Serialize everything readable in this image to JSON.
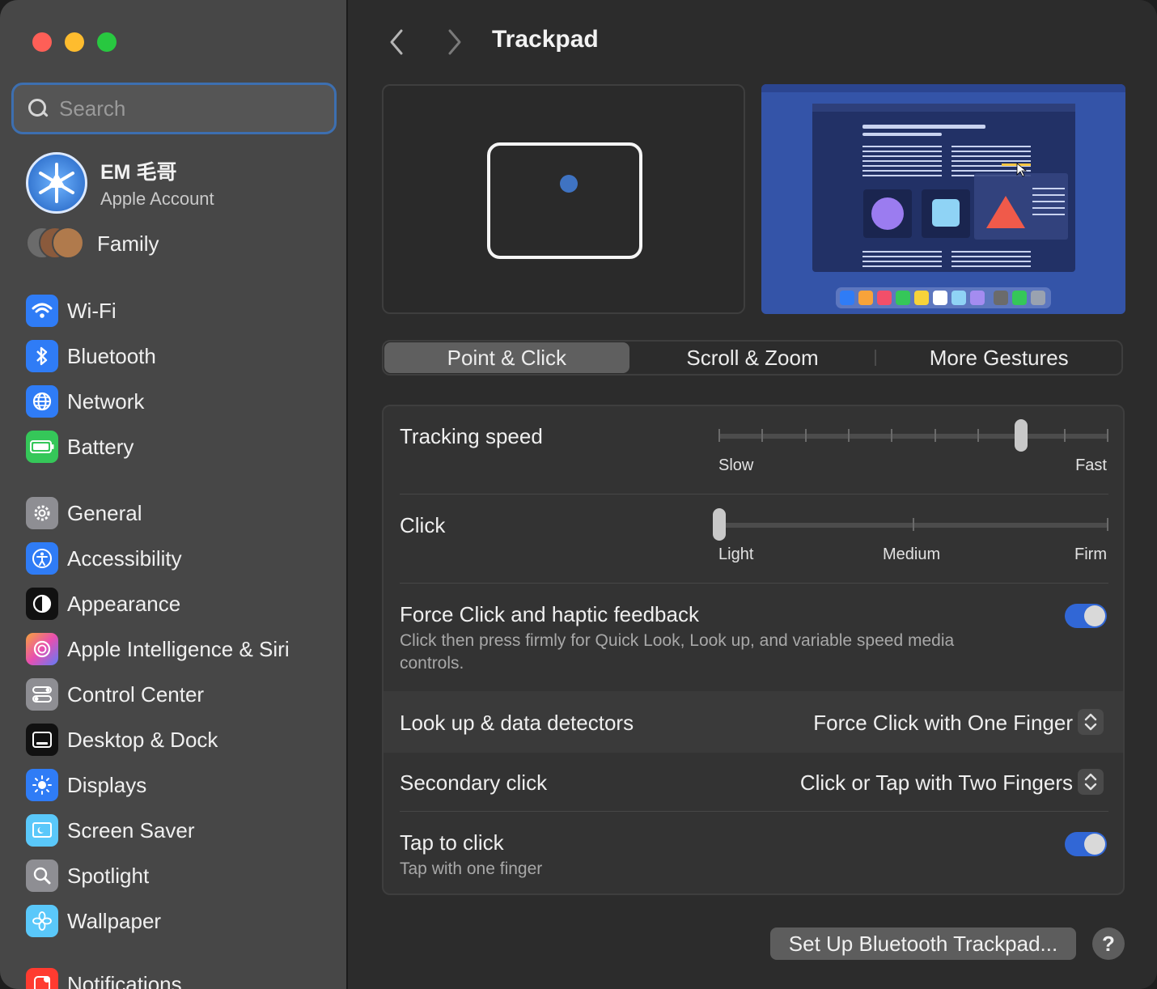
{
  "window": {
    "title": "Trackpad"
  },
  "search": {
    "placeholder": "Search"
  },
  "account": {
    "name": "EM 毛哥",
    "subtitle": "Apple Account"
  },
  "family": {
    "label": "Family"
  },
  "sidebar": {
    "group1": [
      {
        "label": "Wi-Fi",
        "icon": "wifi-icon",
        "color": "#2f7cf6"
      },
      {
        "label": "Bluetooth",
        "icon": "bluetooth-icon",
        "color": "#2f7cf6"
      },
      {
        "label": "Network",
        "icon": "globe-icon",
        "color": "#2f7cf6"
      },
      {
        "label": "Battery",
        "icon": "battery-icon",
        "color": "#35c759"
      }
    ],
    "group2": [
      {
        "label": "General",
        "icon": "gear-icon",
        "color": "#8e8e93"
      },
      {
        "label": "Accessibility",
        "icon": "accessibility-icon",
        "color": "#2f7cf6"
      },
      {
        "label": "Appearance",
        "icon": "appearance-icon",
        "color": "#111111"
      },
      {
        "label": "Apple Intelligence & Siri",
        "icon": "siri-icon",
        "color": "#c86dd7"
      },
      {
        "label": "Control Center",
        "icon": "control-center-icon",
        "color": "#8e8e93"
      },
      {
        "label": "Desktop & Dock",
        "icon": "dock-icon",
        "color": "#111111"
      },
      {
        "label": "Displays",
        "icon": "sun-icon",
        "color": "#2f7cf6"
      },
      {
        "label": "Screen Saver",
        "icon": "screen-saver-icon",
        "color": "#5ac8fa"
      },
      {
        "label": "Spotlight",
        "icon": "spotlight-icon",
        "color": "#8e8e93"
      },
      {
        "label": "Wallpaper",
        "icon": "wallpaper-icon",
        "color": "#5ac8fa"
      }
    ],
    "group3": [
      {
        "label": "Notifications",
        "icon": "notifications-icon",
        "color": "#ff3b30"
      }
    ]
  },
  "tabs": [
    {
      "label": "Point & Click",
      "active": true
    },
    {
      "label": "Scroll & Zoom",
      "active": false
    },
    {
      "label": "More Gestures",
      "active": false
    }
  ],
  "tracking": {
    "label": "Tracking speed",
    "min_label": "Slow",
    "max_label": "Fast",
    "value_index": 7,
    "ticks": 10
  },
  "click": {
    "label": "Click",
    "light": "Light",
    "medium": "Medium",
    "firm": "Firm",
    "value_index": 0,
    "ticks": 3
  },
  "force_click": {
    "label": "Force Click and haptic feedback",
    "description": "Click then press firmly for Quick Look, Look up, and variable speed media controls.",
    "enabled": true
  },
  "lookup": {
    "label": "Look up & data detectors",
    "value": "Force Click with One Finger"
  },
  "secondary": {
    "label": "Secondary click",
    "value": "Click or Tap with Two Fingers"
  },
  "tap": {
    "label": "Tap to click",
    "description": "Tap with one finger",
    "enabled": true
  },
  "footer": {
    "setup_button": "Set Up Bluetooth Trackpad...",
    "help": "?"
  },
  "colors": {
    "accent": "#3167d6",
    "sidebar": "#474747",
    "main": "#2c2c2c"
  }
}
